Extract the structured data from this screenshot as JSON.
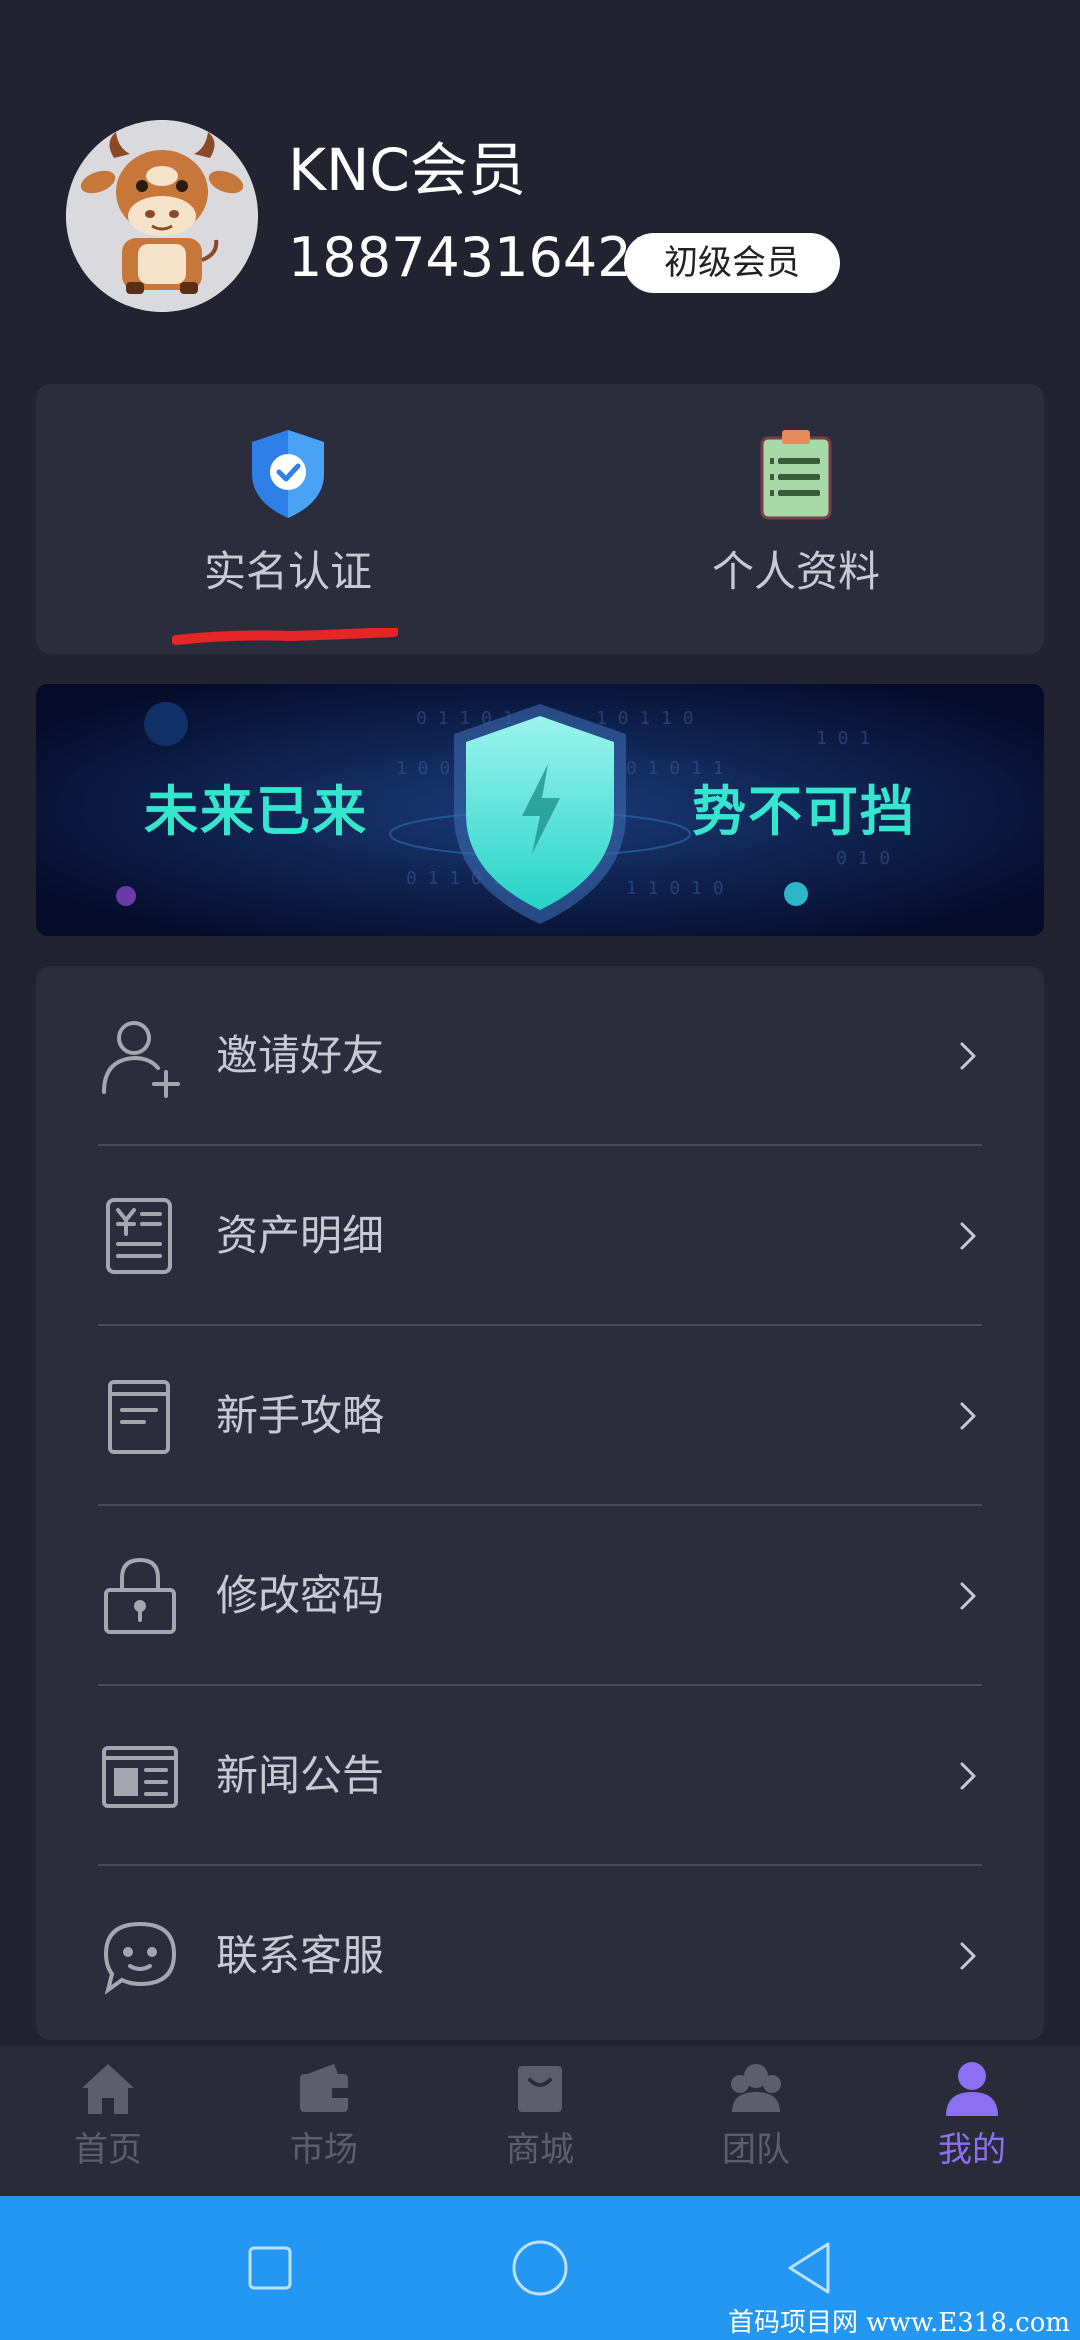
{
  "profile": {
    "name": "KNC会员",
    "phone": "18874316423",
    "level": "初级会员"
  },
  "quick_actions": [
    {
      "label": "实名认证",
      "icon": "shield-check-icon"
    },
    {
      "label": "个人资料",
      "icon": "clipboard-icon"
    }
  ],
  "banner": {
    "left_text": "未来已来",
    "right_text": "势不可挡",
    "icon": "shield-lightning-icon"
  },
  "menu": [
    {
      "label": "邀请好友",
      "icon": "add-user-icon"
    },
    {
      "label": "资产明细",
      "icon": "asset-ledger-icon"
    },
    {
      "label": "新手攻略",
      "icon": "guide-document-icon"
    },
    {
      "label": "修改密码",
      "icon": "lock-icon"
    },
    {
      "label": "新闻公告",
      "icon": "newspaper-icon"
    },
    {
      "label": "联系客服",
      "icon": "chat-bubble-icon"
    }
  ],
  "tabs": [
    {
      "label": "首页",
      "icon": "home-icon",
      "active": false
    },
    {
      "label": "市场",
      "icon": "wallet-icon",
      "active": false
    },
    {
      "label": "商城",
      "icon": "shopping-bag-icon",
      "active": false
    },
    {
      "label": "团队",
      "icon": "team-icon",
      "active": false
    },
    {
      "label": "我的",
      "icon": "user-icon",
      "active": true
    }
  ],
  "system_nav": [
    "recents-square-icon",
    "home-circle-icon",
    "back-triangle-icon"
  ],
  "watermark": "首码项目网 www.E318.com",
  "colors": {
    "background": "#222330",
    "card": "#2c2d3c",
    "accent_active": "#8d6ff2",
    "system_bar": "#2497f2",
    "annotation_red": "#e52626",
    "banner_teal": "#35e6cf"
  }
}
